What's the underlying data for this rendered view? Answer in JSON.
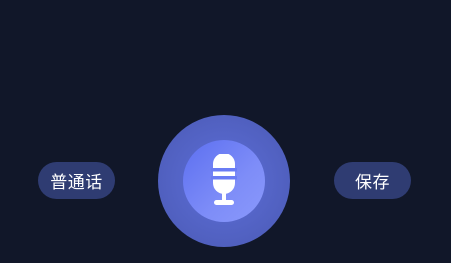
{
  "controls": {
    "language_label": "普通话",
    "save_label": "保存"
  },
  "icons": {
    "record": "microphone-icon"
  },
  "colors": {
    "background": "#111729",
    "pill": "#2f3c72",
    "record_outer": "#5565c4",
    "record_inner": "#6a7cf4"
  }
}
